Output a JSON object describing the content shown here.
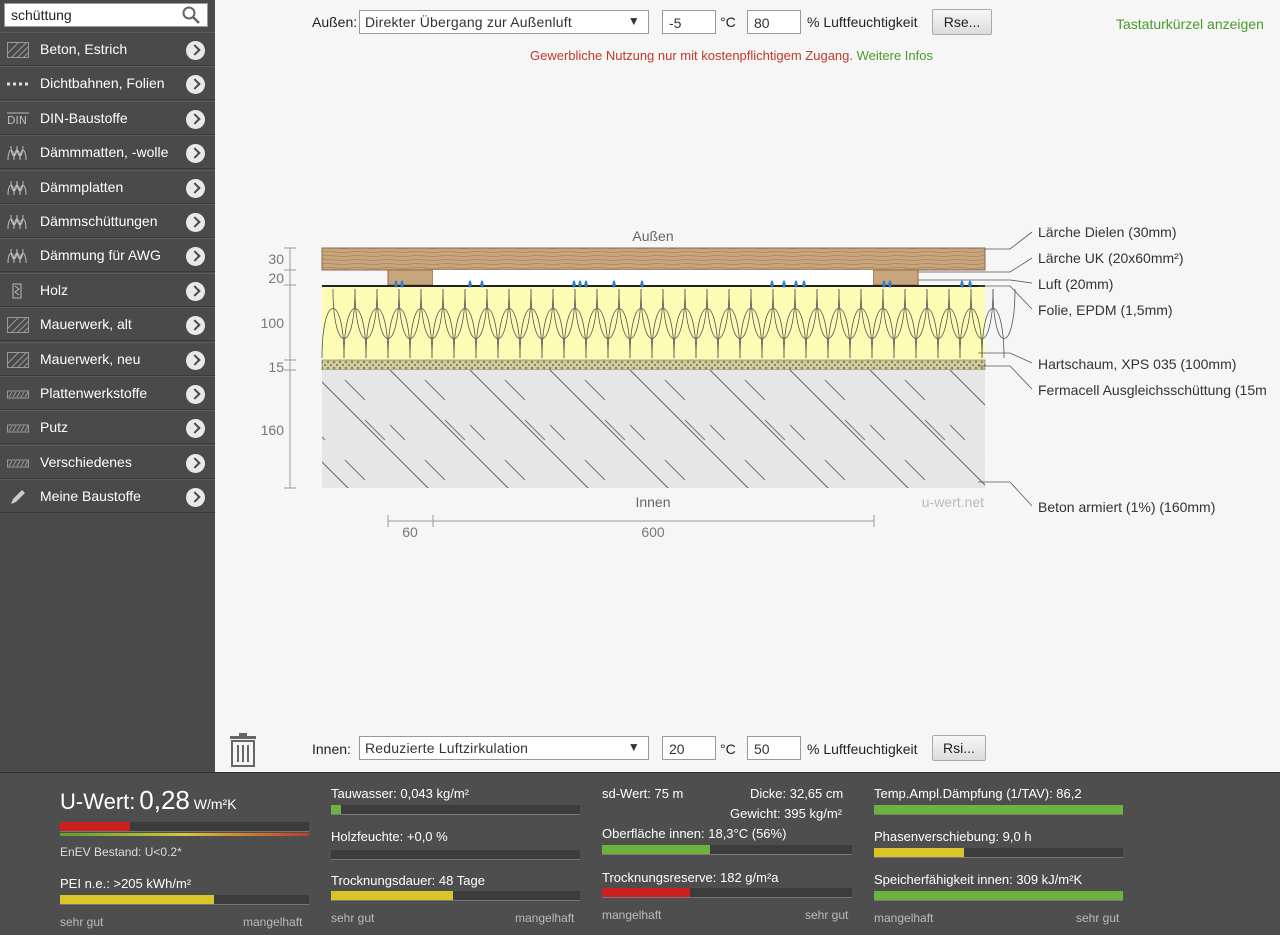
{
  "sidebar": {
    "search_value": "schüttung",
    "categories": [
      {
        "label": "Beton, Estrich",
        "icon": "hatch-icon"
      },
      {
        "label": "Dichtbahnen, Folien",
        "icon": "membrane-icon"
      },
      {
        "label": "DIN-Baustoffe",
        "icon": "din-icon"
      },
      {
        "label": "Dämmmatten, -wolle",
        "icon": "insulation-icon"
      },
      {
        "label": "Dämmplatten",
        "icon": "insulation-icon"
      },
      {
        "label": "Dämmschüttungen",
        "icon": "insulation-icon"
      },
      {
        "label": "Dämmung für AWG",
        "icon": "insulation-icon"
      },
      {
        "label": "Holz",
        "icon": "wood-icon"
      },
      {
        "label": "Mauerwerk, alt",
        "icon": "hatch-icon"
      },
      {
        "label": "Mauerwerk, neu",
        "icon": "hatch-icon"
      },
      {
        "label": "Plattenwerkstoffe",
        "icon": "board-icon"
      },
      {
        "label": "Putz",
        "icon": "board-icon"
      },
      {
        "label": "Verschiedenes",
        "icon": "board-icon"
      },
      {
        "label": "Meine Baustoffe",
        "icon": "pencil-icon"
      }
    ]
  },
  "top": {
    "label": "Außen:",
    "select": "Direkter Übergang zur Außenluft",
    "temp": "-5",
    "temp_unit": "°C",
    "humidity": "80",
    "humidity_label": "% Luftfeuchtigkeit",
    "button": "Rse...",
    "shortcut_link": "Tastaturkürzel anzeigen",
    "notice": "Gewerbliche Nutzung nur mit kostenpflichtigem Zugang.",
    "notice_link": "Weitere Infos"
  },
  "bottom_controls": {
    "label": "Innen:",
    "select": "Reduzierte Luftzirkulation",
    "temp": "20",
    "temp_unit": "°C",
    "humidity": "50",
    "humidity_label": "% Luftfeuchtigkeit",
    "button": "Rsi..."
  },
  "diagram": {
    "outside_label": "Außen",
    "inside_label": "Innen",
    "watermark": "u-wert.net",
    "thickness_labels": [
      "30",
      "20",
      "100",
      "15",
      "160"
    ],
    "width_labels": [
      "60",
      "600"
    ],
    "layers": [
      "Lärche Dielen (30mm)",
      "Lärche UK (20x60mm²)",
      "Luft (20mm)",
      "Folie, EPDM (1,5mm)",
      "Hartschaum, XPS 035 (100mm)",
      "Fermacell Ausgleichsschüttung (15m",
      "Beton armiert (1%) (160mm)"
    ]
  },
  "results": {
    "uwert_label": "U-Wert:",
    "uwert_value": "0,28",
    "uwert_unit": "W/m²K",
    "enev": "EnEV Bestand: U<0.2*",
    "pei": "PEI n.e.: >205 kWh/m²",
    "tauwasser": "Tauwasser: 0,043 kg/m²",
    "holzfeuchte": "Holzfeuchte: +0,0 %",
    "trocknungsdauer": "Trocknungsdauer: 48 Tage",
    "sd": "sd-Wert: 75 m",
    "dicke": "Dicke: 32,65 cm",
    "gewicht": "Gewicht: 395 kg/m²",
    "oberflaeche": "Oberfläche innen: 18,3°C (56%)",
    "trocknungsreserve": "Trocknungsreserve: 182 g/m²a",
    "tav": "Temp.Ampl.Dämpfung (1/TAV): 86,2",
    "phase": "Phasenverschiebung: 9,0 h",
    "speicher": "Speicherfähigkeit innen: 309 kJ/m²K",
    "scale_good": "sehr gut",
    "scale_bad": "mangelhaft",
    "bar_levels": {
      "uwert": 0.28,
      "pei": 0.62,
      "tauwasser": 0.04,
      "holzfeuchte": 0.0,
      "trocknungsdauer": 0.49,
      "oberflaeche": 0.43,
      "trocknungsreserve": 0.35,
      "tav": 1.0,
      "phase": 0.36,
      "speicher": 1.0
    }
  },
  "colors": {
    "red": "#cc1f1f",
    "green": "#6cb33f",
    "yellow": "#d9c429",
    "olive": "#9bb52c",
    "link_green": "#4a9a2a",
    "notice_red": "#c0392b"
  }
}
